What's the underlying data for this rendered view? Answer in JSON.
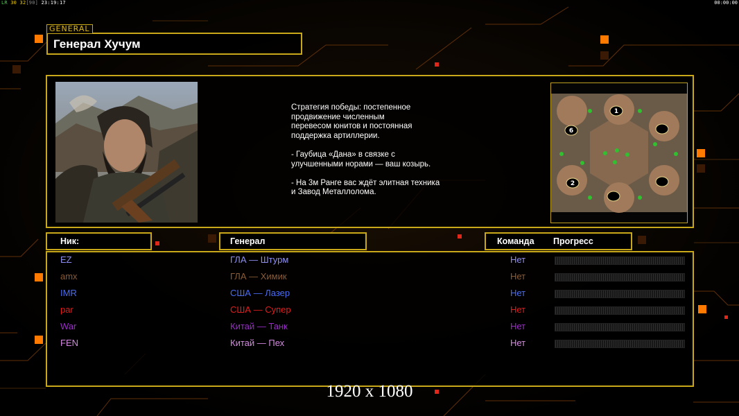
{
  "hud": {
    "lr_label": "LR",
    "fps": "30",
    "logic_fps": "32",
    "logic_cap": "[90]",
    "clock": "23:19:17",
    "timer": "00:00:00"
  },
  "header": {
    "tag": "GENERAL",
    "general_name": "Генерал Хучум"
  },
  "strategy": {
    "text": "Стратегия победы: постепенное\nпродвижение численным\nперевесом юнитов и постоянная\nподдержка артиллерии.\n\n- Гаубица «Дана» в связке с\nулучшенными норами — ваш козырь.\n\n- На 3м Ранге вас ждёт элитная техника\nи Завод Металлолома."
  },
  "minimap": {
    "slots": [
      "1",
      "6",
      "2"
    ]
  },
  "columns": {
    "nick": "Ник:",
    "general": "Генерал",
    "team": "Команда",
    "progress": "Прогресс"
  },
  "players": [
    {
      "nick": "EZ",
      "general": "ГЛА — Штурм",
      "team": "Нет",
      "color": "#8f8ff0",
      "progress": 0
    },
    {
      "nick": "amx",
      "general": "ГЛА — Химик",
      "team": "Нет",
      "color": "#8a5c36",
      "progress": 0
    },
    {
      "nick": "IMR",
      "general": "США — Лазер",
      "team": "Нет",
      "color": "#4a6cf0",
      "progress": 0
    },
    {
      "nick": "par",
      "general": "США — Супер",
      "team": "Нет",
      "color": "#e01e1e",
      "progress": 0
    },
    {
      "nick": "War",
      "general": "Китай — Танк",
      "team": "Нет",
      "color": "#9a2bc8",
      "progress": 0
    },
    {
      "nick": "FEN",
      "general": "Китай — Пех",
      "team": "Нет",
      "color": "#d48ae0",
      "progress": 0
    }
  ],
  "resolution_label": "1920 x 1080",
  "colors": {
    "frame": "#c9a81a",
    "accent_orange": "#ff7a00",
    "accent_red": "#e0281a"
  }
}
